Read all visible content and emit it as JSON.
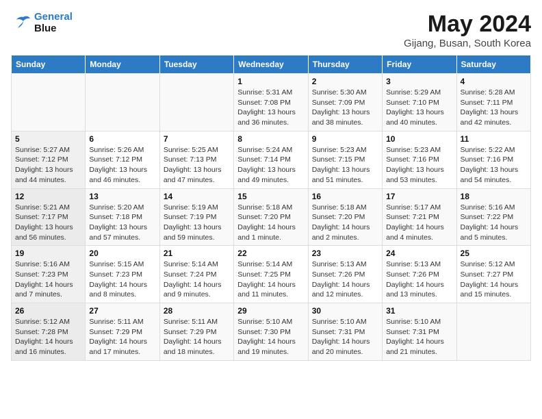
{
  "header": {
    "logo_line1": "General",
    "logo_line2": "Blue",
    "month_year": "May 2024",
    "location": "Gijang, Busan, South Korea"
  },
  "days_of_week": [
    "Sunday",
    "Monday",
    "Tuesday",
    "Wednesday",
    "Thursday",
    "Friday",
    "Saturday"
  ],
  "weeks": [
    [
      {
        "day": "",
        "info": ""
      },
      {
        "day": "",
        "info": ""
      },
      {
        "day": "",
        "info": ""
      },
      {
        "day": "1",
        "info": "Sunrise: 5:31 AM\nSunset: 7:08 PM\nDaylight: 13 hours\nand 36 minutes."
      },
      {
        "day": "2",
        "info": "Sunrise: 5:30 AM\nSunset: 7:09 PM\nDaylight: 13 hours\nand 38 minutes."
      },
      {
        "day": "3",
        "info": "Sunrise: 5:29 AM\nSunset: 7:10 PM\nDaylight: 13 hours\nand 40 minutes."
      },
      {
        "day": "4",
        "info": "Sunrise: 5:28 AM\nSunset: 7:11 PM\nDaylight: 13 hours\nand 42 minutes."
      }
    ],
    [
      {
        "day": "5",
        "info": "Sunrise: 5:27 AM\nSunset: 7:12 PM\nDaylight: 13 hours\nand 44 minutes."
      },
      {
        "day": "6",
        "info": "Sunrise: 5:26 AM\nSunset: 7:12 PM\nDaylight: 13 hours\nand 46 minutes."
      },
      {
        "day": "7",
        "info": "Sunrise: 5:25 AM\nSunset: 7:13 PM\nDaylight: 13 hours\nand 47 minutes."
      },
      {
        "day": "8",
        "info": "Sunrise: 5:24 AM\nSunset: 7:14 PM\nDaylight: 13 hours\nand 49 minutes."
      },
      {
        "day": "9",
        "info": "Sunrise: 5:23 AM\nSunset: 7:15 PM\nDaylight: 13 hours\nand 51 minutes."
      },
      {
        "day": "10",
        "info": "Sunrise: 5:23 AM\nSunset: 7:16 PM\nDaylight: 13 hours\nand 53 minutes."
      },
      {
        "day": "11",
        "info": "Sunrise: 5:22 AM\nSunset: 7:16 PM\nDaylight: 13 hours\nand 54 minutes."
      }
    ],
    [
      {
        "day": "12",
        "info": "Sunrise: 5:21 AM\nSunset: 7:17 PM\nDaylight: 13 hours\nand 56 minutes."
      },
      {
        "day": "13",
        "info": "Sunrise: 5:20 AM\nSunset: 7:18 PM\nDaylight: 13 hours\nand 57 minutes."
      },
      {
        "day": "14",
        "info": "Sunrise: 5:19 AM\nSunset: 7:19 PM\nDaylight: 13 hours\nand 59 minutes."
      },
      {
        "day": "15",
        "info": "Sunrise: 5:18 AM\nSunset: 7:20 PM\nDaylight: 14 hours\nand 1 minute."
      },
      {
        "day": "16",
        "info": "Sunrise: 5:18 AM\nSunset: 7:20 PM\nDaylight: 14 hours\nand 2 minutes."
      },
      {
        "day": "17",
        "info": "Sunrise: 5:17 AM\nSunset: 7:21 PM\nDaylight: 14 hours\nand 4 minutes."
      },
      {
        "day": "18",
        "info": "Sunrise: 5:16 AM\nSunset: 7:22 PM\nDaylight: 14 hours\nand 5 minutes."
      }
    ],
    [
      {
        "day": "19",
        "info": "Sunrise: 5:16 AM\nSunset: 7:23 PM\nDaylight: 14 hours\nand 7 minutes."
      },
      {
        "day": "20",
        "info": "Sunrise: 5:15 AM\nSunset: 7:23 PM\nDaylight: 14 hours\nand 8 minutes."
      },
      {
        "day": "21",
        "info": "Sunrise: 5:14 AM\nSunset: 7:24 PM\nDaylight: 14 hours\nand 9 minutes."
      },
      {
        "day": "22",
        "info": "Sunrise: 5:14 AM\nSunset: 7:25 PM\nDaylight: 14 hours\nand 11 minutes."
      },
      {
        "day": "23",
        "info": "Sunrise: 5:13 AM\nSunset: 7:26 PM\nDaylight: 14 hours\nand 12 minutes."
      },
      {
        "day": "24",
        "info": "Sunrise: 5:13 AM\nSunset: 7:26 PM\nDaylight: 14 hours\nand 13 minutes."
      },
      {
        "day": "25",
        "info": "Sunrise: 5:12 AM\nSunset: 7:27 PM\nDaylight: 14 hours\nand 15 minutes."
      }
    ],
    [
      {
        "day": "26",
        "info": "Sunrise: 5:12 AM\nSunset: 7:28 PM\nDaylight: 14 hours\nand 16 minutes."
      },
      {
        "day": "27",
        "info": "Sunrise: 5:11 AM\nSunset: 7:29 PM\nDaylight: 14 hours\nand 17 minutes."
      },
      {
        "day": "28",
        "info": "Sunrise: 5:11 AM\nSunset: 7:29 PM\nDaylight: 14 hours\nand 18 minutes."
      },
      {
        "day": "29",
        "info": "Sunrise: 5:10 AM\nSunset: 7:30 PM\nDaylight: 14 hours\nand 19 minutes."
      },
      {
        "day": "30",
        "info": "Sunrise: 5:10 AM\nSunset: 7:31 PM\nDaylight: 14 hours\nand 20 minutes."
      },
      {
        "day": "31",
        "info": "Sunrise: 5:10 AM\nSunset: 7:31 PM\nDaylight: 14 hours\nand 21 minutes."
      },
      {
        "day": "",
        "info": ""
      }
    ]
  ]
}
